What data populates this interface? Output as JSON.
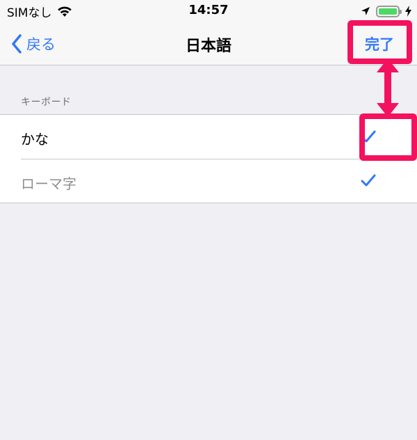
{
  "status_bar": {
    "carrier": "SIMなし",
    "time": "14:57",
    "icons": [
      "wifi-icon",
      "location-arrow-icon",
      "battery-icon",
      "charging-bolt-icon"
    ]
  },
  "nav": {
    "back_label": "戻る",
    "title": "日本語",
    "done_label": "完了"
  },
  "section": {
    "header": "キーボード"
  },
  "keyboards": [
    {
      "label": "かな",
      "checked": true,
      "enabled": true
    },
    {
      "label": "ローマ字",
      "checked": true,
      "enabled": false
    }
  ],
  "colors": {
    "accent": "#3478f6",
    "annotation": "#f4125e",
    "background": "#efeff4"
  }
}
